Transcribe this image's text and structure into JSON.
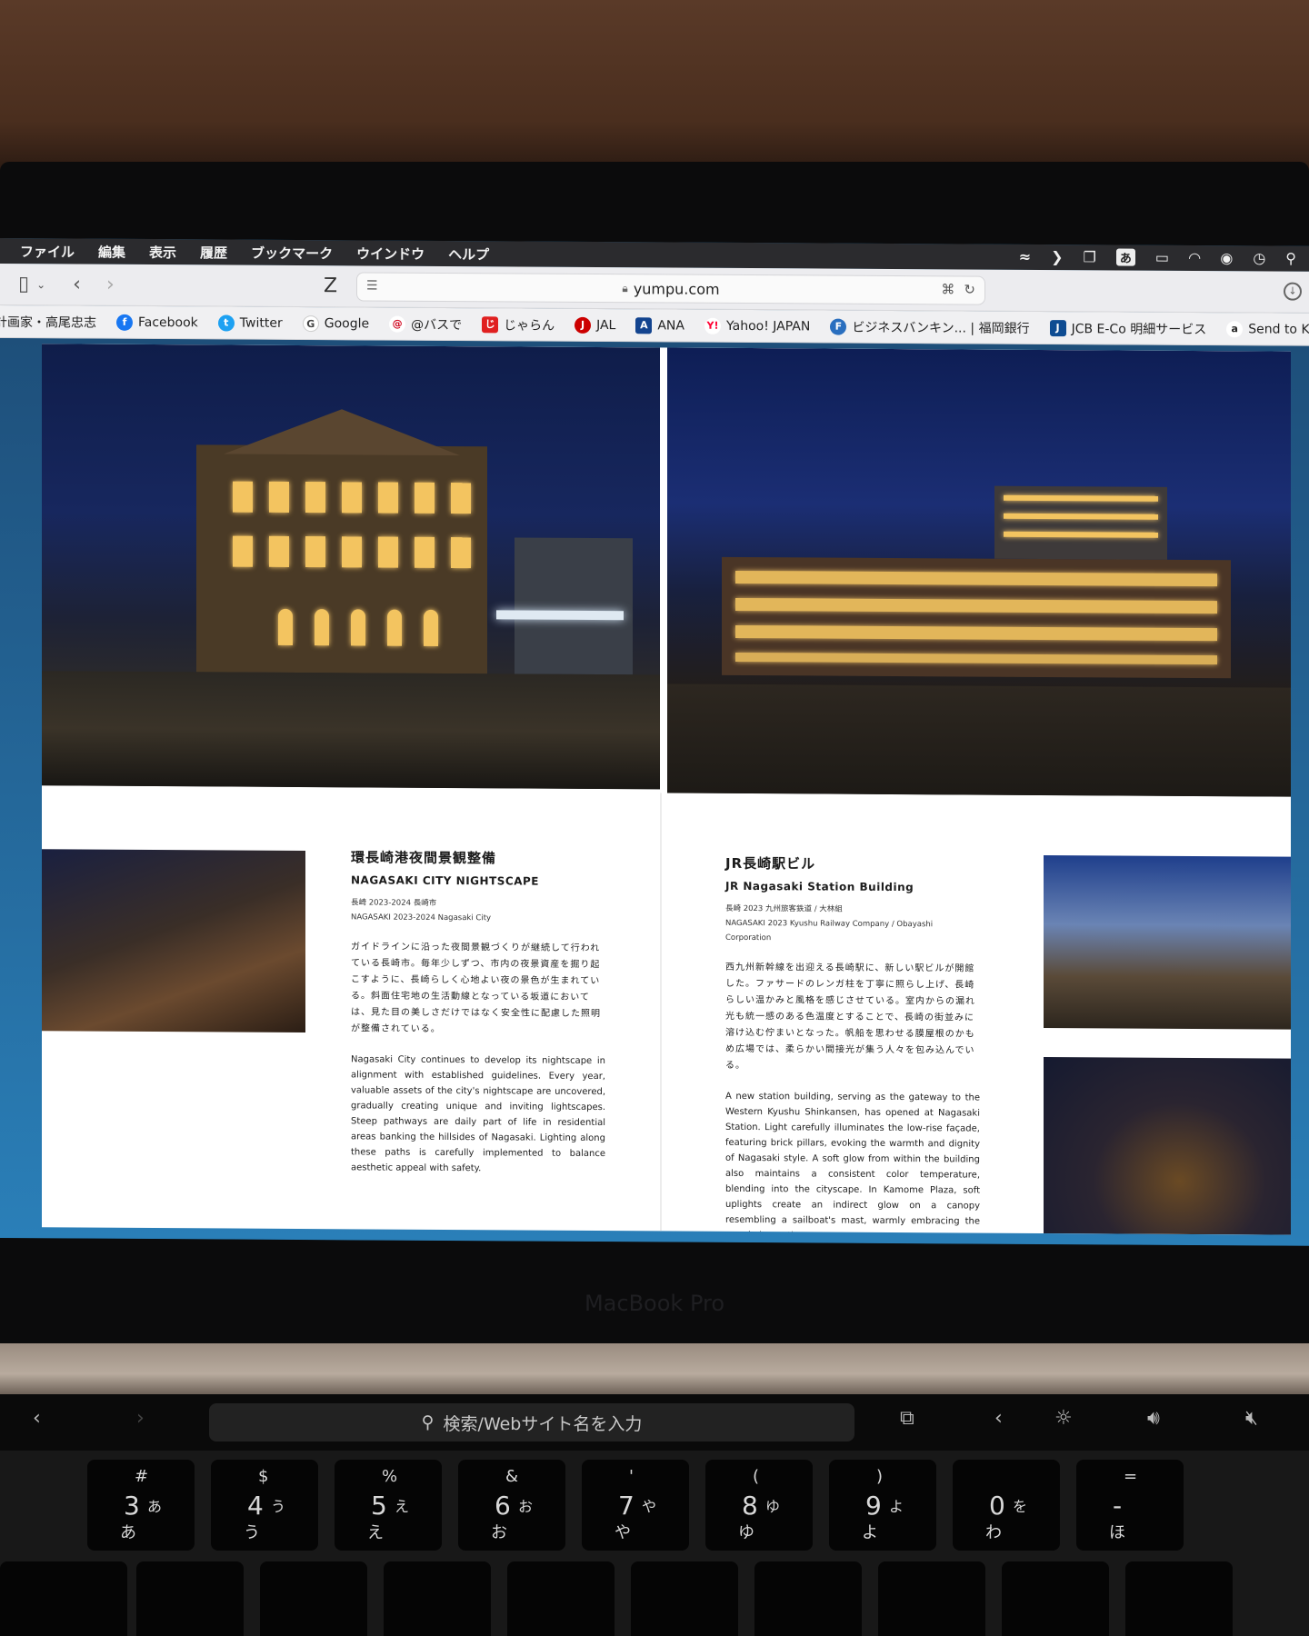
{
  "menubar": {
    "items": [
      "ファイル",
      "編集",
      "表示",
      "履歴",
      "ブックマーク",
      "ウインドウ",
      "ヘルプ"
    ],
    "ime_label": "あ"
  },
  "toolbar": {
    "z_label": "Z",
    "url": "yumpu.com"
  },
  "bookmarks": [
    {
      "label": "計画家・高尾忠志",
      "icon": "none",
      "color": ""
    },
    {
      "label": "Facebook",
      "icon": "facebook-icon",
      "color": "#1877f2"
    },
    {
      "label": "Twitter",
      "icon": "twitter-icon",
      "color": "#1da1f2"
    },
    {
      "label": "Google",
      "icon": "google-icon",
      "color": "#4a4a4a"
    },
    {
      "label": "@バスで",
      "icon": "at-icon",
      "color": "#d0021b"
    },
    {
      "label": "じゃらん",
      "icon": "jalan-icon",
      "color": "#e02020"
    },
    {
      "label": "JAL",
      "icon": "jal-icon",
      "color": "#cc0000"
    },
    {
      "label": "ANA",
      "icon": "ana-icon",
      "color": "#13448f"
    },
    {
      "label": "Yahoo! JAPAN",
      "icon": "yahoo-icon",
      "color": "#ff0033"
    },
    {
      "label": "ビジネスバンキン... | 福岡銀行",
      "icon": "bank-icon",
      "color": "#2a6fbf"
    },
    {
      "label": "JCB E-Co 明細サービス",
      "icon": "jcb-icon",
      "color": "#0e4c92"
    },
    {
      "label": "Send to Kindle",
      "icon": "amazon-icon",
      "color": "#222222"
    }
  ],
  "left_article": {
    "title_jp": "環長崎港夜間景観整備",
    "title_en": "NAGASAKI CITY NIGHTSCAPE",
    "meta_jp": "長崎 2023-2024 長崎市",
    "meta_en": "NAGASAKI 2023-2024 Nagasaki City",
    "body_jp": "ガイドラインに沿った夜間景観づくりが継続して行われている長崎市。毎年少しずつ、市内の夜景資産を掘り起こすように、長崎らしく心地よい夜の景色が生まれている。斜面住宅地の生活動線となっている坂道においては、見た目の美しさだけではなく安全性に配慮した照明が整備されている。",
    "body_en": "Nagasaki City continues to develop its nightscape in alignment with established guidelines. Every year, valuable assets of the city's nightscape are uncovered, gradually creating unique and inviting lightscapes. Steep pathways are daily part of life in residential areas banking the hillsides of Nagasaki. Lighting along these paths is carefully implemented to balance aesthetic appeal with safety."
  },
  "right_article": {
    "title_jp": "JR長崎駅ビル",
    "title_en": "JR Nagasaki Station Building",
    "meta_jp": "長崎 2023 九州旅客鉄道 / 大林組",
    "meta_en": "NAGASAKI 2023 Kyushu Railway Company / Obayashi Corporation",
    "body_jp": "西九州新幹線を出迎える長崎駅に、新しい駅ビルが開館した。ファサードのレンガ柱を丁寧に照らし上げ、長崎らしい温かみと風格を感じさせている。室内からの漏れ光も統一感のある色温度とすることで、長崎の街並みに溶け込む佇まいとなった。帆船を思わせる膜屋根のかもめ広場では、柔らかい間接光が集う人々を包み込んでいる。",
    "body_en": "A new station building, serving as the gateway to the Western Kyushu Shinkansen, has opened at Nagasaki Station. Light carefully illuminates the low-rise façade, featuring brick pillars, evoking the warmth and dignity of Nagasaki style. A soft glow from within the building also maintains a consistent color temperature, blending into the cityscape. In Kamome Plaza, soft uplights create an indirect glow on a canopy resembling a sailboat's mast, warmly embracing the people beneath."
  },
  "laptop": {
    "brand": "MacBook Pro",
    "touchbar_search": "検索/Webサイト名を入力"
  },
  "keys": [
    {
      "main": "3",
      "sub": "#",
      "kana": "あ",
      "kana2": "あ"
    },
    {
      "main": "4",
      "sub": "$",
      "kana": "う",
      "kana2": "う"
    },
    {
      "main": "5",
      "sub": "%",
      "kana": "え",
      "kana2": "え"
    },
    {
      "main": "6",
      "sub": "&",
      "kana": "お",
      "kana2": "お"
    },
    {
      "main": "7",
      "sub": "'",
      "kana": "や",
      "kana2": "や"
    },
    {
      "main": "8",
      "sub": "(",
      "kana": "ゆ",
      "kana2": "ゆ"
    },
    {
      "main": "9",
      "sub": ")",
      "kana": "よ",
      "kana2": "よ"
    },
    {
      "main": "0",
      "sub": "",
      "kana": "を",
      "kana2": "わ"
    },
    {
      "main": "-",
      "sub": "=",
      "kana": "",
      "kana2": "ほ"
    }
  ]
}
